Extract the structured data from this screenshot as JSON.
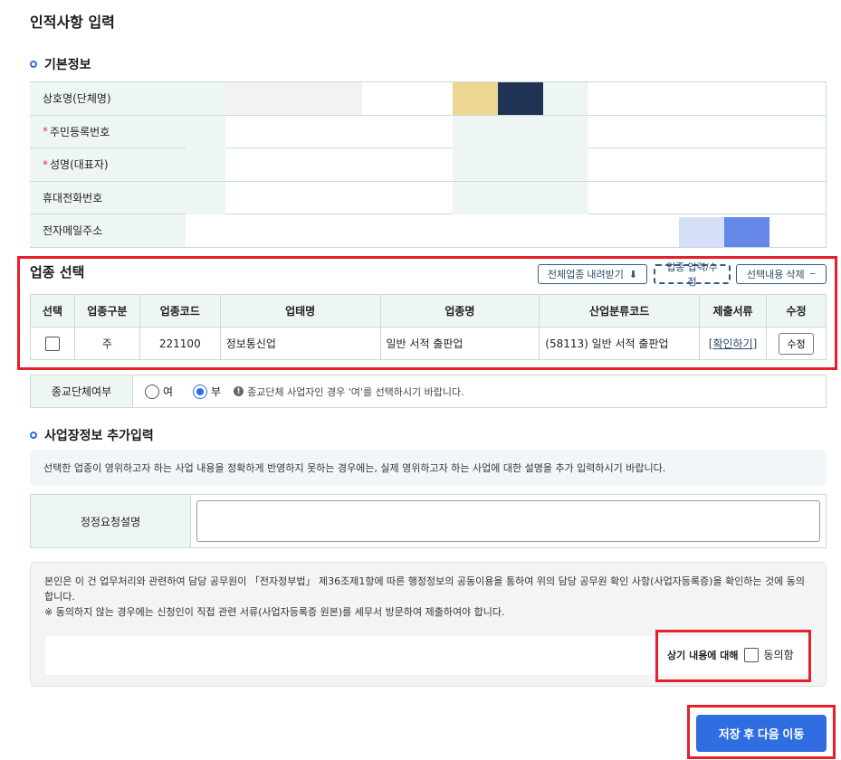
{
  "page_title": "인적사항 입력",
  "basic_section": {
    "title": "기본정보",
    "rows": [
      {
        "label": "상호명(단체명)",
        "required": false
      },
      {
        "label": "주민등록번호",
        "required": true
      },
      {
        "label": "성명(대표자)",
        "required": true
      },
      {
        "label": "휴대전화번호",
        "required": false
      },
      {
        "label": "전자메일주소",
        "required": false
      }
    ],
    "required_mark": "*"
  },
  "industry_section": {
    "title": "업종 선택",
    "buttons": {
      "download": "전체업종 내려받기",
      "input_edit": "업종 입력/수정",
      "delete": "선택내용 삭제"
    },
    "columns": [
      "선택",
      "업종구분",
      "업종코드",
      "업태명",
      "업종명",
      "산업분류코드",
      "제출서류",
      "수정"
    ],
    "rows": [
      {
        "type": "주",
        "code": "221100",
        "business_type": "정보통신업",
        "industry_name": "일반 서적 출판업",
        "classification": "(58113) 일반 서적 출판업",
        "documents": "[확인하기]",
        "edit": "수정"
      }
    ]
  },
  "religion": {
    "label": "종교단체여부",
    "options": [
      "여",
      "부"
    ],
    "selected": "부",
    "hint": "종교단체 사업자인 경우 '여'를 선택하시기 바랍니다."
  },
  "additional_section": {
    "title": "사업장정보 추가입력",
    "notice": "선택한 업종이 영위하고자 하는 사업 내용을 정확하게 반영하지 못하는 경우에는, 실제 영위하고자 하는 사업에 대한 설명을 추가 입력하시기 바랍니다.",
    "field_label": "정정요청설명",
    "field_value": ""
  },
  "consent": {
    "text1": "본인은 이 건 업무처리와 관련하여 담당 공무원이 「전자정부법」 제36조제1항에 따른 행정정보의 공동이용을 통하여 위의 담당 공무원 확인 사항(사업자등록증)을 확인하는 것에 동의합니다.",
    "text2": "※  동의하지 않는 경우에는 신청인이 직접 관련 서류(사업자등록증 원본)를 세무서 방문하여 제출하여야 합니다.",
    "agree_prefix": "상기 내용에 대해",
    "agree_label": "동의함"
  },
  "save_button": "저장 후 다음 이동",
  "colors": {
    "accent": "#2f6de1",
    "highlight": "#e5202a",
    "header_bg": "#eef6f4"
  }
}
